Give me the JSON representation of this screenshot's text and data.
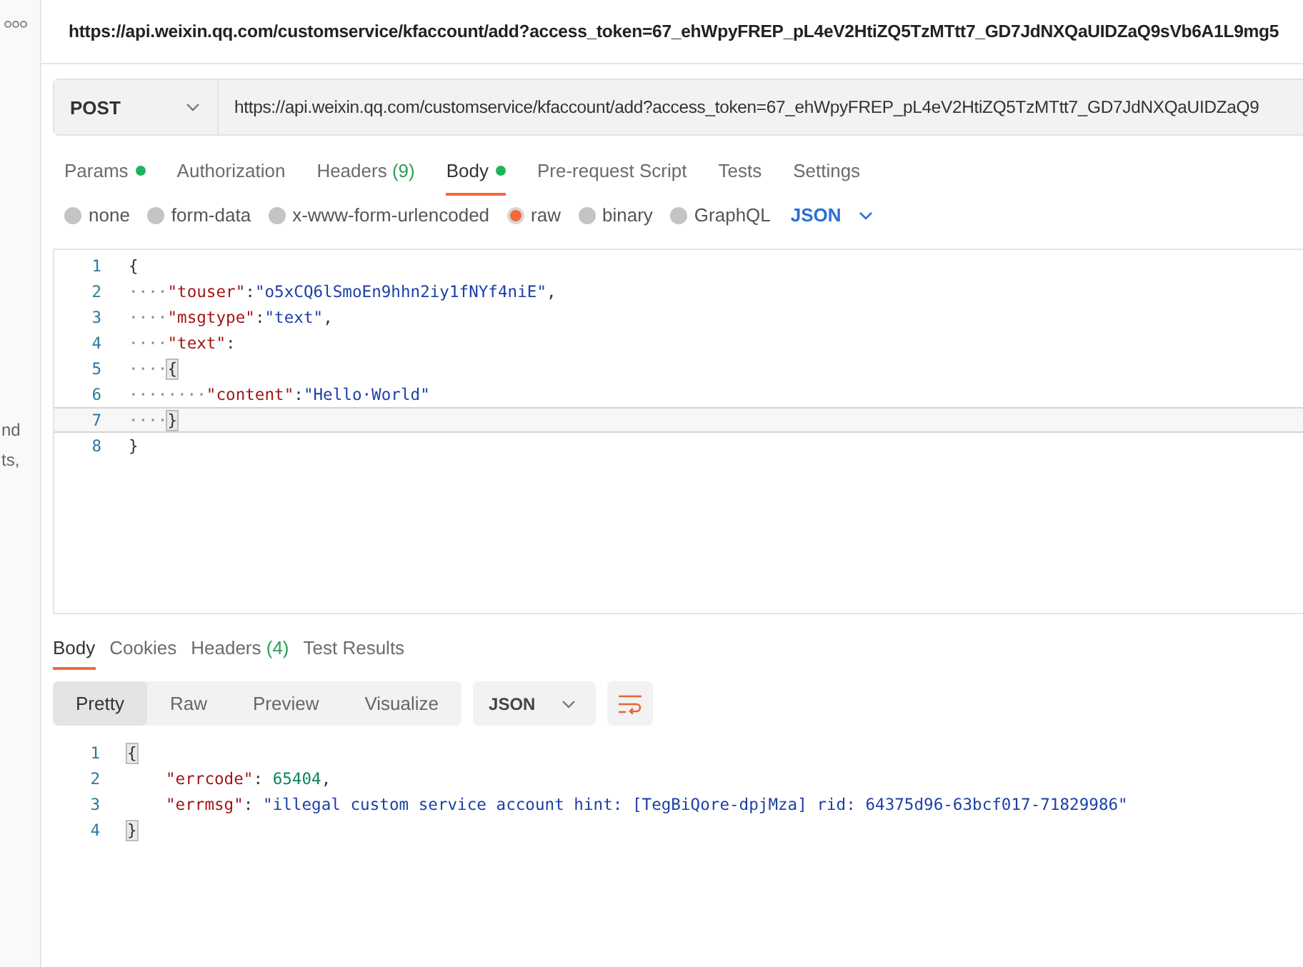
{
  "sidebar": {
    "fragments": [
      "nd",
      "ts,"
    ]
  },
  "title": "https://api.weixin.qq.com/customservice/kfaccount/add?access_token=67_ehWpyFREP_pL4eV2HtiZQ5TzMTtt7_GD7JdNXQaUIDZaQ9sVb6A1L9mg5",
  "request": {
    "method": "POST",
    "url": "https://api.weixin.qq.com/customservice/kfaccount/add?access_token=67_ehWpyFREP_pL4eV2HtiZQ5TzMTtt7_GD7JdNXQaUIDZaQ9"
  },
  "tabs": [
    {
      "label": "Params",
      "dot": true,
      "selected": false
    },
    {
      "label": "Authorization",
      "dot": false,
      "selected": false
    },
    {
      "label": "Headers",
      "count": "(9)",
      "dot": false,
      "selected": false
    },
    {
      "label": "Body",
      "dot": true,
      "selected": true
    },
    {
      "label": "Pre-request Script",
      "dot": false,
      "selected": false
    },
    {
      "label": "Tests",
      "dot": false,
      "selected": false
    },
    {
      "label": "Settings",
      "dot": false,
      "selected": false
    }
  ],
  "body_types": [
    {
      "label": "none",
      "selected": false
    },
    {
      "label": "form-data",
      "selected": false
    },
    {
      "label": "x-www-form-urlencoded",
      "selected": false
    },
    {
      "label": "raw",
      "selected": true
    },
    {
      "label": "binary",
      "selected": false
    },
    {
      "label": "GraphQL",
      "selected": false
    }
  ],
  "language": "JSON",
  "editor": {
    "lines": [
      {
        "number": "1",
        "current": false,
        "tokens": [
          {
            "kind": "punct",
            "text": "{"
          }
        ]
      },
      {
        "number": "2",
        "current": false,
        "tokens": [
          {
            "kind": "ws",
            "text": "····"
          },
          {
            "kind": "key",
            "text": "\"touser\""
          },
          {
            "kind": "punct",
            "text": ":"
          },
          {
            "kind": "string",
            "text": "\"o5xCQ6lSmoEn9hhn2iy1fNYf4niE\""
          },
          {
            "kind": "punct",
            "text": ","
          }
        ]
      },
      {
        "number": "3",
        "current": false,
        "tokens": [
          {
            "kind": "ws",
            "text": "····"
          },
          {
            "kind": "key",
            "text": "\"msgtype\""
          },
          {
            "kind": "punct",
            "text": ":"
          },
          {
            "kind": "string",
            "text": "\"text\""
          },
          {
            "kind": "punct",
            "text": ","
          }
        ]
      },
      {
        "number": "4",
        "current": false,
        "tokens": [
          {
            "kind": "ws",
            "text": "····"
          },
          {
            "kind": "key",
            "text": "\"text\""
          },
          {
            "kind": "punct",
            "text": ":"
          }
        ]
      },
      {
        "number": "5",
        "current": false,
        "tokens": [
          {
            "kind": "ws",
            "text": "····"
          },
          {
            "kind": "bracket",
            "text": "{"
          }
        ]
      },
      {
        "number": "6",
        "current": false,
        "tokens": [
          {
            "kind": "ws",
            "text": "········"
          },
          {
            "kind": "key",
            "text": "\"content\""
          },
          {
            "kind": "punct",
            "text": ":"
          },
          {
            "kind": "string",
            "text": "\"Hello·World\""
          }
        ]
      },
      {
        "number": "7",
        "current": true,
        "tokens": [
          {
            "kind": "ws",
            "text": "····"
          },
          {
            "kind": "bracket",
            "text": "}"
          }
        ]
      },
      {
        "number": "8",
        "current": false,
        "tokens": [
          {
            "kind": "punct",
            "text": "}"
          }
        ]
      }
    ]
  },
  "response": {
    "tabs": [
      {
        "label": "Body",
        "selected": true
      },
      {
        "label": "Cookies",
        "selected": false
      },
      {
        "label": "Headers",
        "count": "(4)",
        "selected": false
      },
      {
        "label": "Test Results",
        "selected": false
      }
    ],
    "views": [
      {
        "label": "Pretty",
        "selected": true
      },
      {
        "label": "Raw",
        "selected": false
      },
      {
        "label": "Preview",
        "selected": false
      },
      {
        "label": "Visualize",
        "selected": false
      }
    ],
    "format": "JSON",
    "lines": [
      {
        "number": "1",
        "indented": false,
        "tokens": [
          {
            "kind": "bracket",
            "text": "{"
          }
        ]
      },
      {
        "number": "2",
        "indented": true,
        "tokens": [
          {
            "kind": "key",
            "text": "\"errcode\""
          },
          {
            "kind": "punct",
            "text": ": "
          },
          {
            "kind": "number",
            "text": "65404"
          },
          {
            "kind": "punct",
            "text": ","
          }
        ]
      },
      {
        "number": "3",
        "indented": true,
        "tokens": [
          {
            "kind": "key",
            "text": "\"errmsg\""
          },
          {
            "kind": "punct",
            "text": ": "
          },
          {
            "kind": "string",
            "text": "\"illegal custom service account hint: [TegBiQore-dpjMza] rid: 64375d96-63bcf017-71829986\""
          }
        ]
      },
      {
        "number": "4",
        "indented": false,
        "tokens": [
          {
            "kind": "bracket",
            "text": "}"
          }
        ]
      }
    ]
  }
}
